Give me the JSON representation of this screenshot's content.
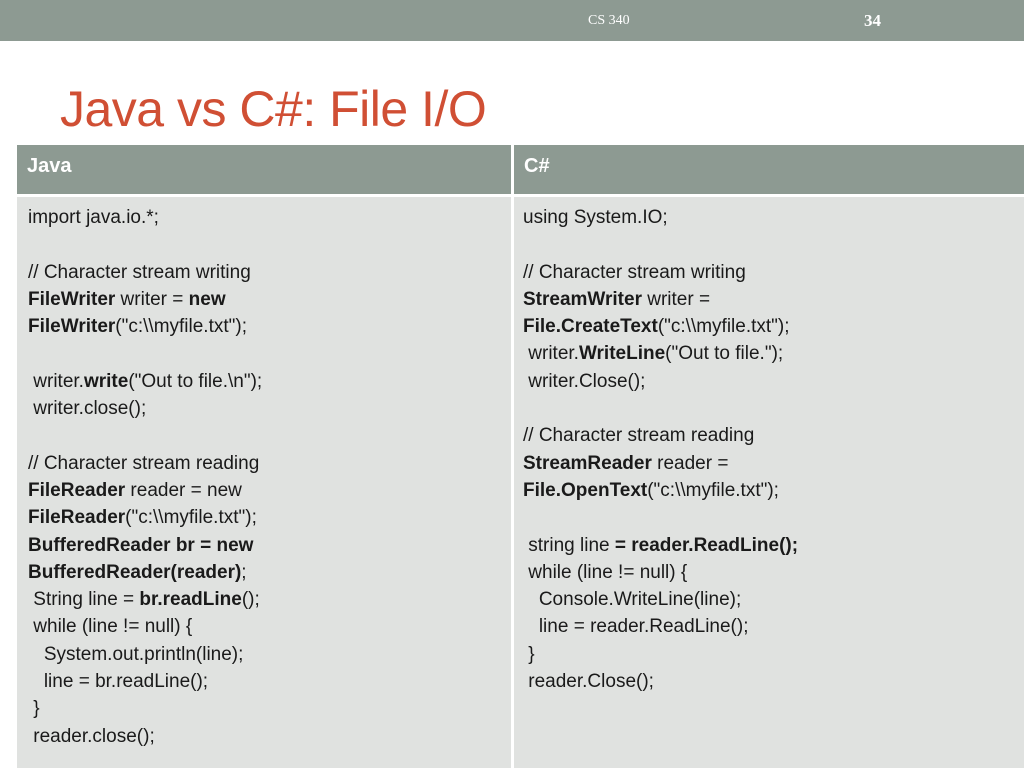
{
  "header": {
    "course": "CS 340",
    "page_number": "34"
  },
  "title": "Java vs C#: File I/O",
  "table": {
    "columns": [
      "Java",
      "C#"
    ],
    "java_lines": [
      [
        {
          "t": "import java.io.*;"
        }
      ],
      [],
      [
        {
          "t": "// Character stream writing"
        }
      ],
      [
        {
          "t": "FileWriter",
          "b": true
        },
        {
          "t": " writer = "
        },
        {
          "t": "new",
          "b": true
        }
      ],
      [
        {
          "t": "FileWriter",
          "b": true
        },
        {
          "t": "(\"c:\\\\myfile.txt\");"
        }
      ],
      [],
      [
        {
          "t": " writer."
        },
        {
          "t": "write",
          "b": true
        },
        {
          "t": "(\"Out to file.\\n\");"
        }
      ],
      [
        {
          "t": " writer.close();"
        }
      ],
      [],
      [
        {
          "t": "// Character stream reading"
        }
      ],
      [
        {
          "t": "FileReader",
          "b": true
        },
        {
          "t": " reader = new"
        }
      ],
      [
        {
          "t": "FileReader",
          "b": true
        },
        {
          "t": "(\"c:\\\\myfile.txt\");"
        }
      ],
      [
        {
          "t": "BufferedReader br = new",
          "b": true
        }
      ],
      [
        {
          "t": "BufferedReader(reader)",
          "b": true
        },
        {
          "t": ";"
        }
      ],
      [
        {
          "t": " String line = "
        },
        {
          "t": "br.readLine",
          "b": true
        },
        {
          "t": "();"
        }
      ],
      [
        {
          "t": " while (line != null) {"
        }
      ],
      [
        {
          "t": "   System.out.println(line);"
        }
      ],
      [
        {
          "t": "   line = br.readLine();"
        }
      ],
      [
        {
          "t": " }"
        }
      ],
      [
        {
          "t": " reader.close();"
        }
      ]
    ],
    "csharp_lines": [
      [
        {
          "t": "using System.IO;"
        }
      ],
      [],
      [
        {
          "t": "// Character stream writing"
        }
      ],
      [
        {
          "t": "StreamWriter",
          "b": true
        },
        {
          "t": " writer ="
        }
      ],
      [
        {
          "t": "File.CreateText",
          "b": true
        },
        {
          "t": "(\"c:\\\\myfile.txt\");"
        }
      ],
      [
        {
          "t": " writer."
        },
        {
          "t": "WriteLine",
          "b": true
        },
        {
          "t": "(\"Out to file.\");"
        }
      ],
      [
        {
          "t": " writer.Close();"
        }
      ],
      [],
      [
        {
          "t": "// Character stream reading"
        }
      ],
      [
        {
          "t": "StreamReader",
          "b": true
        },
        {
          "t": " reader ="
        }
      ],
      [
        {
          "t": "File.OpenText",
          "b": true
        },
        {
          "t": "(\"c:\\\\myfile.txt\");"
        }
      ],
      [],
      [
        {
          "t": " string line "
        },
        {
          "t": "= reader.ReadLine();",
          "b": true
        }
      ],
      [
        {
          "t": " while (line != null) {"
        }
      ],
      [
        {
          "t": "   Console.WriteLine(line);"
        }
      ],
      [
        {
          "t": "   line = reader.ReadLine();"
        }
      ],
      [
        {
          "t": " }"
        }
      ],
      [
        {
          "t": " reader.Close();"
        }
      ]
    ]
  },
  "colors": {
    "accent": "#d04f34",
    "bar": "#8d9a92",
    "cell": "#e0e2e0"
  }
}
